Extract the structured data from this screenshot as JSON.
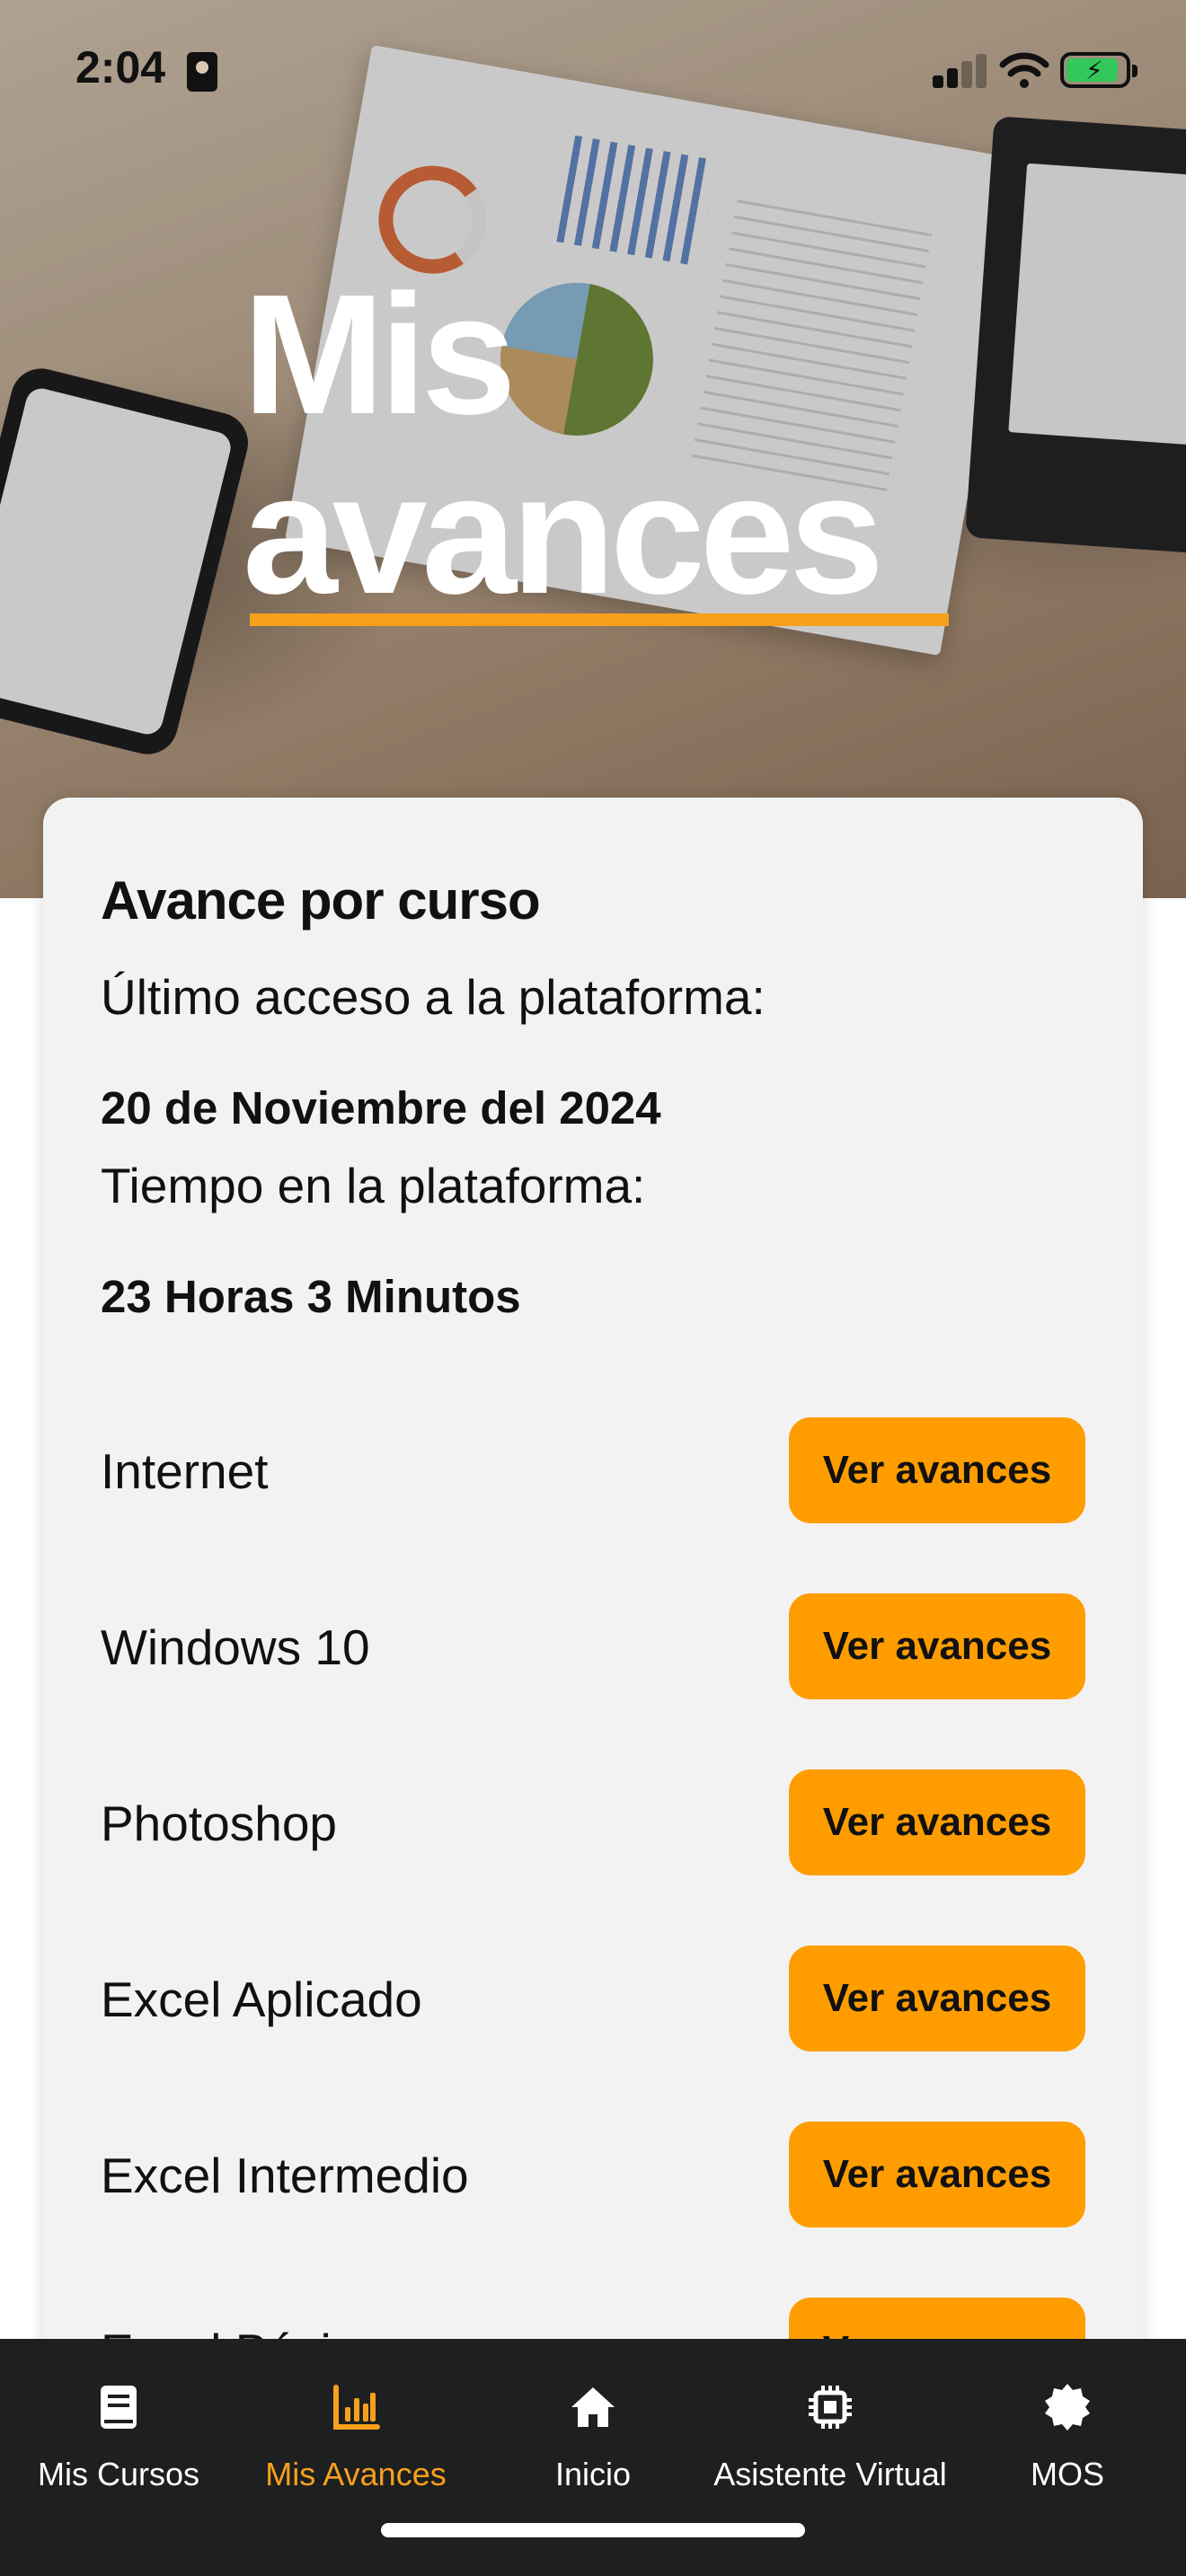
{
  "status_bar": {
    "time": "2:04"
  },
  "hero": {
    "title_line1": "Mis",
    "title_line2": "avances"
  },
  "card": {
    "title": "Avance por curso",
    "last_access_label": "Último acceso a la plataforma:",
    "last_access_value": "20 de Noviembre del 2024",
    "time_label": "Tiempo en la plataforma:",
    "time_value": "23 Horas 3 Minutos",
    "courses": [
      {
        "name": "Internet",
        "button": "Ver avances"
      },
      {
        "name": "Windows 10",
        "button": "Ver avances"
      },
      {
        "name": "Photoshop",
        "button": "Ver avances"
      },
      {
        "name": "Excel Aplicado",
        "button": "Ver avances"
      },
      {
        "name": "Excel Intermedio",
        "button": "Ver avances"
      },
      {
        "name": "Excel Básico",
        "button": "Ver avances"
      }
    ]
  },
  "nav": {
    "items": [
      {
        "label": "Mis Cursos",
        "icon": "book-icon"
      },
      {
        "label": "Mis Avances",
        "icon": "chart-icon",
        "active": true
      },
      {
        "label": "Inicio",
        "icon": "home-icon"
      },
      {
        "label": "Asistente Virtual",
        "icon": "chip-icon"
      },
      {
        "label": "MOS",
        "icon": "badge-icon"
      }
    ]
  },
  "colors": {
    "accent": "#f7a01b",
    "button": "#ff9d00",
    "nav_bg": "#1d1f21",
    "card_bg": "#f2f2f2",
    "battery": "#34c759"
  }
}
